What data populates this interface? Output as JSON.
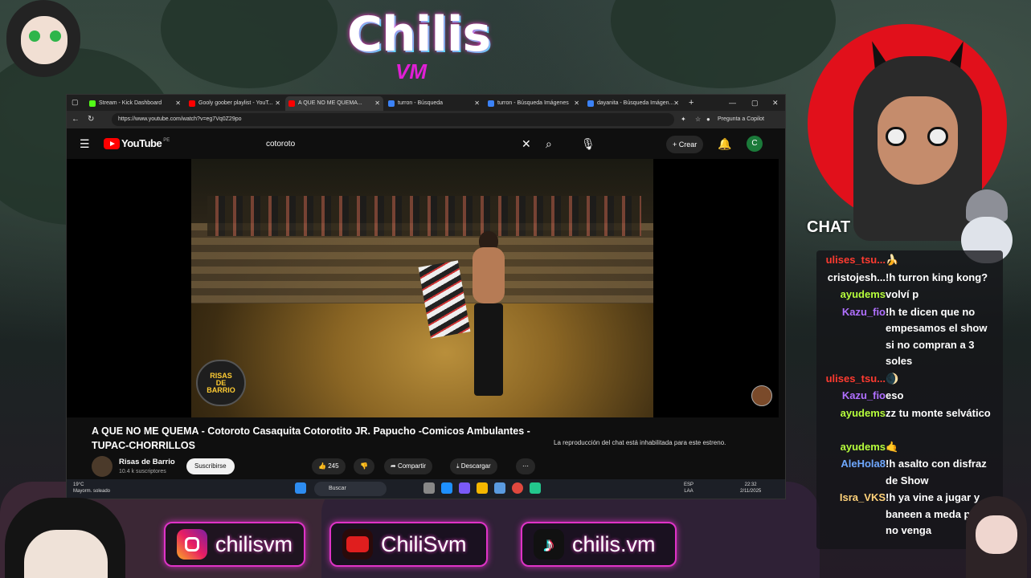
{
  "logo": {
    "main": "Chilis",
    "sub": "VM"
  },
  "browser": {
    "tabs": [
      {
        "label": "Stream - Kick Dashboard",
        "color": "#53fc18"
      },
      {
        "label": "Gooly goober playlist - YouT...",
        "color": "#ff0000"
      },
      {
        "label": "A QUE NO ME QUEMA...",
        "color": "#ff0000"
      },
      {
        "label": "turron - Búsqueda",
        "color": "#3b82f6"
      },
      {
        "label": "turron - Búsqueda Imágenes",
        "color": "#3b82f6"
      },
      {
        "label": "dayanita - Búsqueda Imágen...",
        "color": "#3b82f6"
      }
    ],
    "new_tab": "+",
    "url": "https://www.youtube.com/watch?v=eg7Vq0Z29po",
    "copilot": "Pregunta a Copilot"
  },
  "youtube": {
    "logo_text": "YouTube",
    "region": "PE",
    "search_value": "cotoroto",
    "create_label": "Crear",
    "account_initial": "C",
    "channel_badge": [
      "RISAS",
      "DE",
      "BARRIO"
    ],
    "video_title": "A QUE NO ME QUEMA - Cotoroto Casaquita Cotorotito JR. Papucho -Comicos Ambulantes - TUPAC-CHORRILLOS",
    "channel_name": "Risas de Barrio",
    "subscribers": "10.4 k suscriptores",
    "subscribe_label": "Suscribirse",
    "likes": "245",
    "share_label": "Compartir",
    "download_label": "Descargar",
    "chat_disabled": "La reproducción del chat está inhabilitada para este estreno."
  },
  "taskbar": {
    "temp": "19°C",
    "weather": "Mayorm. soleado",
    "search_label": "Buscar",
    "lang": "ESP",
    "layout": "LAA",
    "time": "22:32",
    "date": "2/11/2025"
  },
  "chat": {
    "title": "CHAT",
    "messages": [
      {
        "user": "ulises_tsu...",
        "color": "#ff3b30",
        "text": "🍌"
      },
      {
        "user": "cristojesh...",
        "color": "#ffffff",
        "text": "!h turron king kong?"
      },
      {
        "user": "ayudems",
        "color": "#b7ff3c",
        "text": "volví p"
      },
      {
        "user": "Kazu_fio",
        "color": "#b070ff",
        "text": "!h te dicen que no empesamos el show si no compran a 3 soles"
      },
      {
        "user": "ulises_tsu...",
        "color": "#ff3b30",
        "text": "🌒"
      },
      {
        "user": "Kazu_fio",
        "color": "#b070ff",
        "text": "eso"
      },
      {
        "user": "ayudems",
        "color": "#b7ff3c",
        "text": "zz tu monte selvático"
      },
      {
        "user": "ayudems",
        "color": "#b7ff3c",
        "text": "🤙"
      },
      {
        "user": "AleHola8",
        "color": "#6fa8ff",
        "text": "!h asalto con disfraz de Show"
      },
      {
        "user": "Isra_VKS",
        "color": "#ffd27a",
        "text": "!h ya vine a jugar y baneen a meda pa que no venga"
      }
    ]
  },
  "socials": [
    {
      "icon": "instagram-icon",
      "handle": "chilisvm"
    },
    {
      "icon": "youtube-icon",
      "handle": "ChiliSvm"
    },
    {
      "icon": "tiktok-icon",
      "handle": "chilis.vm"
    }
  ]
}
